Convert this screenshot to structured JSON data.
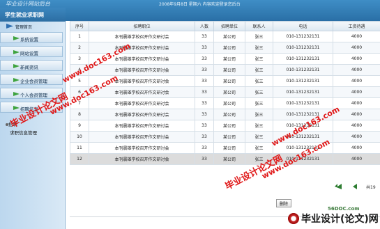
{
  "header": {
    "logo_text": "毕业设计网站后台",
    "date_text": "2008年9月8日 星期六 内容欢迎登录您后台"
  },
  "sidebar": {
    "title": "学生就业求职网",
    "home_label": "管理首页",
    "items": [
      {
        "label": "系统设置"
      },
      {
        "label": "网站设置"
      },
      {
        "label": "新闻资讯"
      },
      {
        "label": "企业会员管理"
      },
      {
        "label": "个人会员管理"
      },
      {
        "label": "招聘信息"
      }
    ],
    "sub_items": [
      {
        "label": "招聘"
      },
      {
        "label": "求职信息管理"
      }
    ]
  },
  "table": {
    "columns": [
      "序号",
      "招聘职位",
      "人数",
      "招聘单位",
      "联系人",
      "电话",
      "工资待遇"
    ],
    "rows": [
      [
        "1",
        "本刊晨雄学校召开作文研讨会",
        "33",
        "某公司",
        "张三",
        "010-131232131",
        "4000"
      ],
      [
        "2",
        "本刊晨雄学校召开作文研讨会",
        "33",
        "某公司",
        "张三",
        "010-131232131",
        "4000"
      ],
      [
        "3",
        "本刊晨雄学校召开作文研讨会",
        "33",
        "某公司",
        "张三",
        "010-131232131",
        "4000"
      ],
      [
        "4",
        "本刊晨雄学校召开作文研讨会",
        "33",
        "某公司",
        "张三",
        "010-131232131",
        "4000"
      ],
      [
        "5",
        "本刊晨雄学校召开作文研讨会",
        "33",
        "某公司",
        "张三",
        "010-131232131",
        "4000"
      ],
      [
        "6",
        "本刊晨雄学校召开作文研讨会",
        "33",
        "某公司",
        "张三",
        "010-131232131",
        "4000"
      ],
      [
        "7",
        "本刊晨雄学校召开作文研讨会",
        "33",
        "某公司",
        "张三",
        "010-131232131",
        "4000"
      ],
      [
        "8",
        "本刊晨雄学校召开作文研讨会",
        "33",
        "某公司",
        "张三",
        "010-131232131",
        "4000"
      ],
      [
        "9",
        "本刊晨雄学校召开作文研讨会",
        "33",
        "某公司",
        "张三",
        "010-131232131",
        "4000"
      ],
      [
        "10",
        "本刊晨雄学校召开作文研讨会",
        "33",
        "某公司",
        "张三",
        "010-131232131",
        "4000"
      ],
      [
        "11",
        "本刊晨雄学校召开作文研讨会",
        "33",
        "某公司",
        "张三",
        "010-131232131",
        "4000"
      ],
      [
        "12",
        "本刊晨雄学校召开作文研讨会",
        "33",
        "某公司",
        "张三",
        "010-131232131",
        "4000"
      ]
    ]
  },
  "pager": {
    "total_text": "共19"
  },
  "actions": {
    "delete_label": "删除"
  },
  "watermarks": {
    "site": "www.doc163.com",
    "cn": "毕业设计论文网",
    "corner_site": "56DOC.com",
    "corner_cn": "毕业设计(论文)网"
  }
}
